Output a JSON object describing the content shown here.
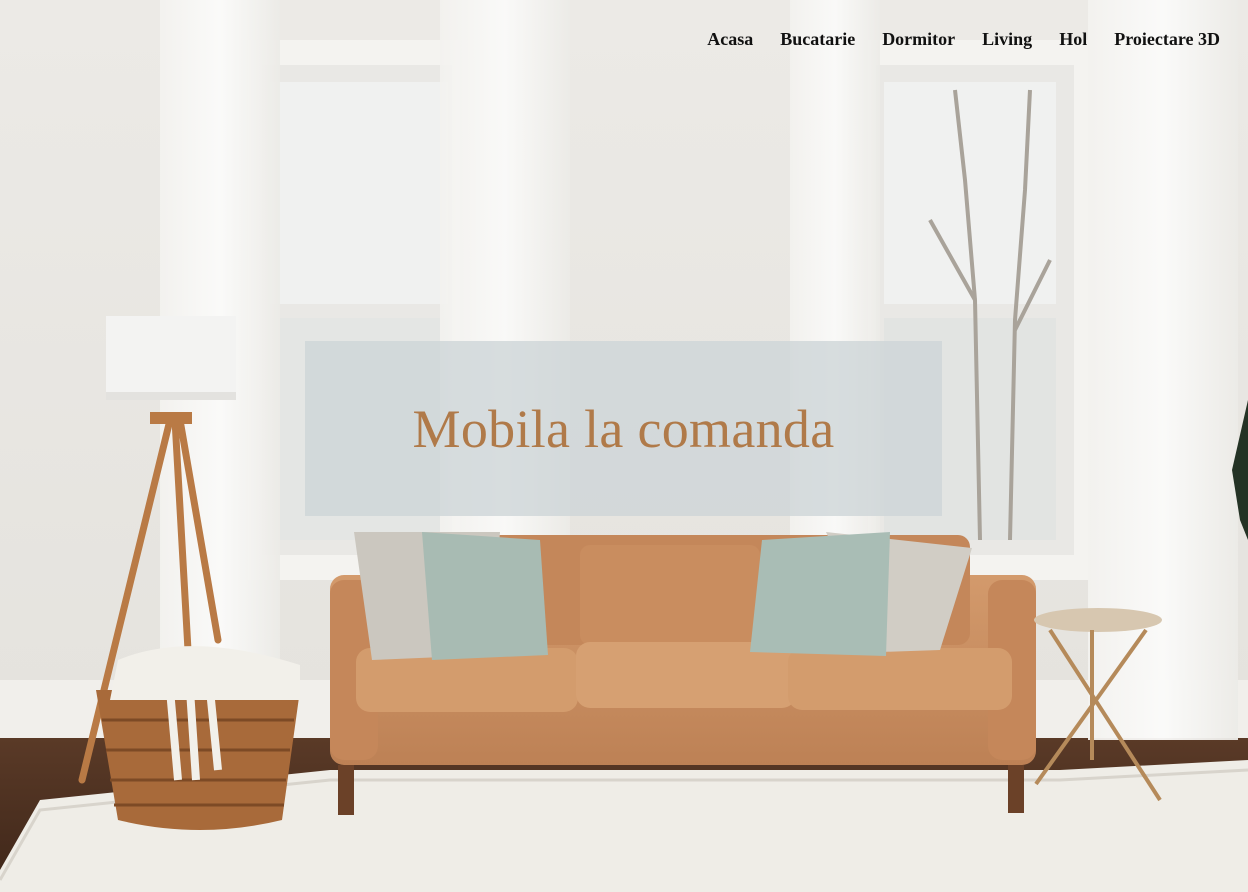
{
  "nav": {
    "items": [
      "Acasa",
      "Bucatarie",
      "Dormitor",
      "Living",
      "Hol",
      "Proiectare 3D"
    ]
  },
  "hero": {
    "title": "Mobila la comanda"
  },
  "colors": {
    "title": "#b07a49",
    "nav_text": "#111111",
    "overlay": "#cdd5d7",
    "sofa": "#c98d5f",
    "pillow_green": "#a9bdb5",
    "pillow_grey": "#c9c5bd",
    "wall": "#e9e7e2"
  }
}
